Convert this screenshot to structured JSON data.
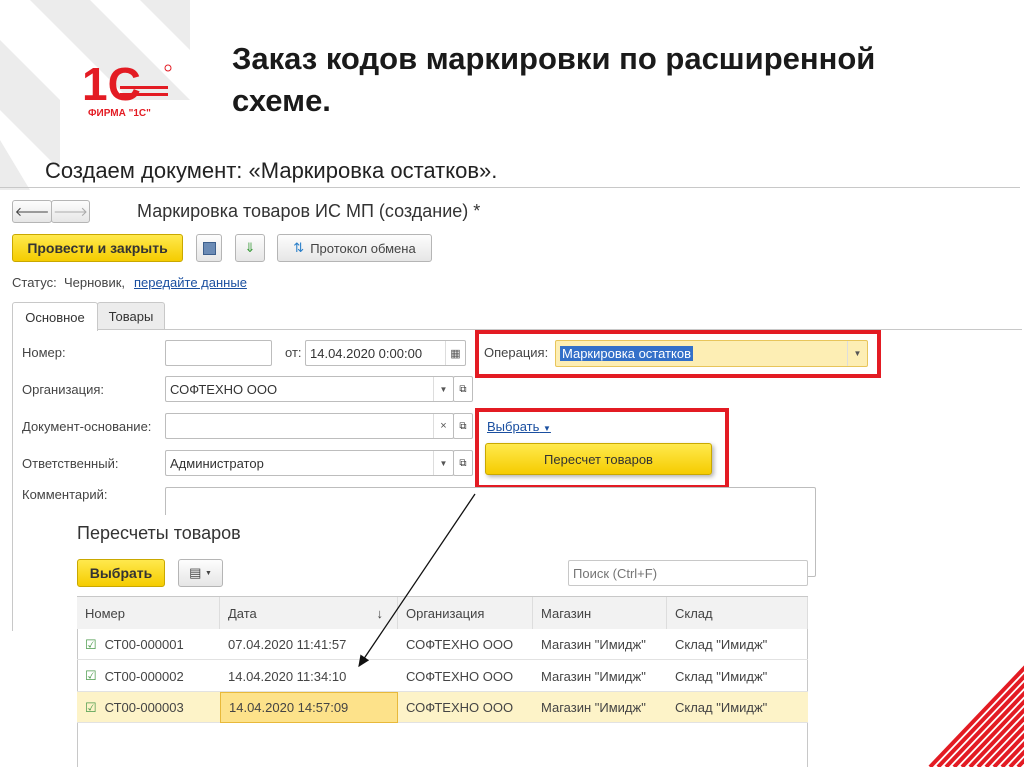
{
  "slide": {
    "title": "Заказ кодов маркировки по расширенной схеме.",
    "subtitle": "Создаем документ: «Маркировка остатков».",
    "logo_text": "1С",
    "logo_caption": "ФИРМА \"1С\""
  },
  "colors": {
    "accent_red": "#e31b23",
    "button_yellow": "#f5cc00",
    "selection": "#fff3c4"
  },
  "window": {
    "title": "Маркировка товаров ИС МП (создание) *",
    "back_icon": "arrow-left-icon",
    "forward_icon": "arrow-right-icon"
  },
  "toolbar": {
    "post_close": "Провести и закрыть",
    "save_icon": "floppy-disk-icon",
    "report_icon": "document-arrow-icon",
    "exchange_log": "Протокол обмена"
  },
  "status": {
    "label": "Статус:",
    "value": "Черновик,",
    "link": "передайте данные"
  },
  "tabs": [
    {
      "label": "Основное",
      "active": true
    },
    {
      "label": "Товары",
      "active": false
    }
  ],
  "form": {
    "number_label": "Номер:",
    "number_value": "",
    "from_label": "от:",
    "date_value": "14.04.2020  0:00:00",
    "operation_label": "Операция:",
    "operation_value": "Маркировка остатков",
    "org_label": "Организация:",
    "org_value": "СОФТЕХНО ООО",
    "base_label": "Документ-основание:",
    "base_value": "",
    "select_link": "Выбрать",
    "select_menu_item": "Пересчет товаров",
    "resp_label": "Ответственный:",
    "resp_value": "Администратор",
    "comment_label": "Комментарий:",
    "comment_value": ""
  },
  "list": {
    "title": "Пересчеты товаров",
    "select_button": "Выбрать",
    "search_placeholder": "Поиск (Ctrl+F)",
    "columns": [
      "Номер",
      "Дата",
      "Организация",
      "Магазин",
      "Склад"
    ],
    "sort_indicator": "↓",
    "rows": [
      {
        "number": "СТ00-000001",
        "date": "07.04.2020 11:41:57",
        "org": "СОФТЕХНО ООО",
        "shop": "Магазин \"Имидж\"",
        "warehouse": "Склад \"Имидж\""
      },
      {
        "number": "СТ00-000002",
        "date": "14.04.2020 11:34:10",
        "org": "СОФТЕХНО ООО",
        "shop": "Магазин \"Имидж\"",
        "warehouse": "Склад \"Имидж\""
      },
      {
        "number": "СТ00-000003",
        "date": "14.04.2020 14:57:09",
        "org": "СОФТЕХНО ООО",
        "shop": "Магазин \"Имидж\"",
        "warehouse": "Склад \"Имидж\"",
        "selected": true
      }
    ]
  }
}
